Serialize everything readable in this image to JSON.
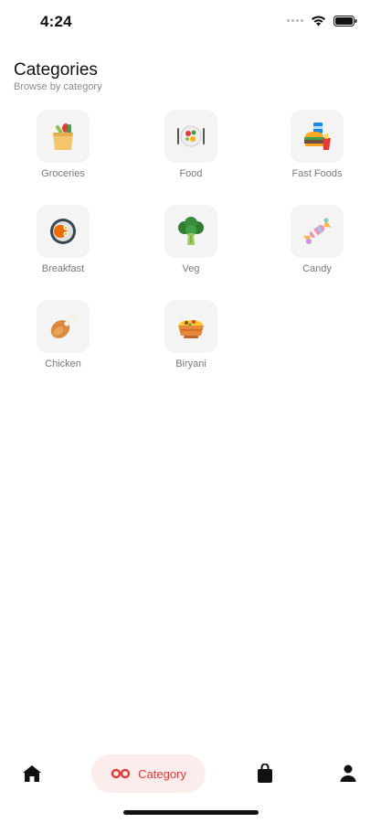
{
  "status": {
    "time": "4:24"
  },
  "header": {
    "title": "Categories",
    "subtitle": "Browse by category"
  },
  "categories": [
    {
      "label": "Groceries",
      "icon": "grocery-bag-icon"
    },
    {
      "label": "Food",
      "icon": "food-plate-icon"
    },
    {
      "label": "Fast Foods",
      "icon": "fast-food-icon"
    },
    {
      "label": "Breakfast",
      "icon": "breakfast-icon"
    },
    {
      "label": "Veg",
      "icon": "broccoli-icon"
    },
    {
      "label": "Candy",
      "icon": "candy-icon"
    },
    {
      "label": "Chicken",
      "icon": "chicken-leg-icon"
    },
    {
      "label": "Biryani",
      "icon": "biryani-bowl-icon"
    }
  ],
  "bottom_nav": {
    "active_label": "Category",
    "accent_color": "#e53935",
    "items": [
      "home-icon",
      "category-icon",
      "bag-icon",
      "profile-icon"
    ]
  }
}
